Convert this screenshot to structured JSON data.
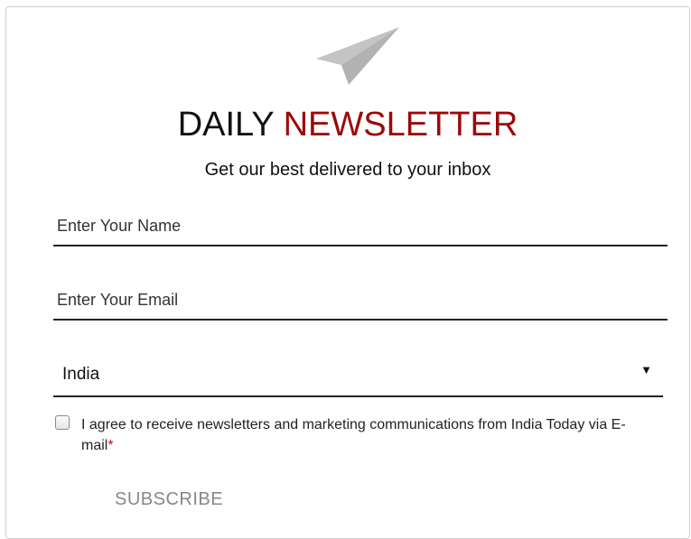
{
  "header": {
    "icon": "paper-plane-icon",
    "title_main": "DAILY ",
    "title_accent": "NEWSLETTER",
    "subtitle": "Get our best delivered to your inbox"
  },
  "form": {
    "name_placeholder": "Enter Your Name",
    "email_placeholder": "Enter Your Email",
    "country_selected": "India",
    "consent_text": "I agree to receive newsletters and marketing communications from India Today via E- mail",
    "required_marker": "*",
    "consent_checked": false,
    "subscribe_label": "SUBSCRIBE"
  },
  "colors": {
    "accent": "#9b0a0a",
    "required": "#d0021b",
    "icon": "#bdbdbd",
    "button_text": "#888888"
  }
}
